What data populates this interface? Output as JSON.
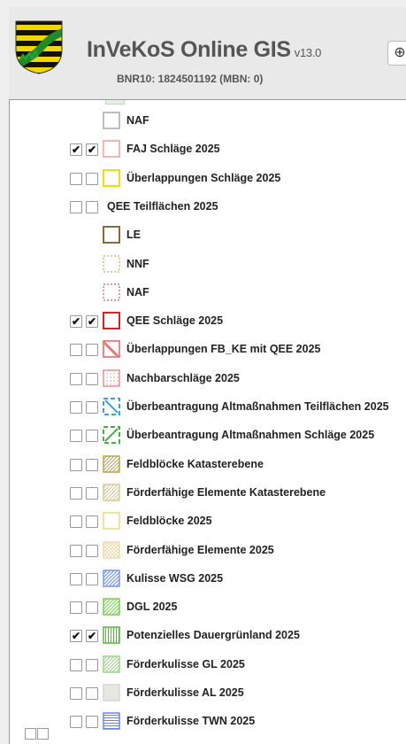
{
  "header": {
    "app_title": "InVeKoS Online GIS",
    "version": "v13.0",
    "bnr": "BNR10: 1824501192 (MBN: 0)",
    "zoom_in_label": "⊕"
  },
  "layers": [
    {
      "label": "NAF",
      "indent": "sub",
      "c1": null,
      "c2": null,
      "symbol": "naf-gray-square"
    },
    {
      "label": "FAJ Schläge 2025",
      "indent": "main",
      "c1": true,
      "c2": true,
      "symbol": "pink-outline-square"
    },
    {
      "label": "Überlappungen Schläge 2025",
      "indent": "main",
      "c1": false,
      "c2": false,
      "symbol": "yellow-outline-square"
    },
    {
      "label": "QEE Teilflächen 2025",
      "indent": "group",
      "c1": false,
      "c2": false,
      "symbol": null
    },
    {
      "label": "LE",
      "indent": "sub",
      "c1": null,
      "c2": null,
      "symbol": "brown-outline-square"
    },
    {
      "label": "NNF",
      "indent": "sub",
      "c1": null,
      "c2": null,
      "symbol": "tan-dotted-square"
    },
    {
      "label": "NAF",
      "indent": "sub",
      "c1": null,
      "c2": null,
      "symbol": "red-dotted-square"
    },
    {
      "label": "QEE Schläge 2025",
      "indent": "main",
      "c1": true,
      "c2": true,
      "symbol": "red-outline-square"
    },
    {
      "label": "Überlappungen FB_KE mit QEE 2025",
      "indent": "main",
      "c1": false,
      "c2": false,
      "symbol": "red-hatched-square"
    },
    {
      "label": "Nachbarschläge 2025",
      "indent": "main",
      "c1": false,
      "c2": false,
      "symbol": "red-dotgrid-square"
    },
    {
      "label": "Überbeantragung Altmaßnahmen Teilflächen 2025",
      "indent": "main",
      "c1": false,
      "c2": false,
      "symbol": "blue-dashed-square"
    },
    {
      "label": "Überbeantragung Altmaßnahmen Schläge 2025",
      "indent": "main",
      "c1": false,
      "c2": false,
      "symbol": "green-dashed-square"
    },
    {
      "label": "Feldblöcke Katasterebene",
      "indent": "main",
      "c1": false,
      "c2": false,
      "symbol": "olive-hatched-square"
    },
    {
      "label": "Förderfähige Elemente Katasterebene",
      "indent": "main",
      "c1": false,
      "c2": false,
      "symbol": "khaki-hatched-square"
    },
    {
      "label": "Feldblöcke 2025",
      "indent": "main",
      "c1": false,
      "c2": false,
      "symbol": "lightyellow-outline-square"
    },
    {
      "label": "Förderfähige Elemente 2025",
      "indent": "main",
      "c1": false,
      "c2": false,
      "symbol": "beige-crosshatch-square"
    },
    {
      "label": "Kulisse WSG 2025",
      "indent": "main",
      "c1": false,
      "c2": false,
      "symbol": "blue-hatched-square"
    },
    {
      "label": "DGL 2025",
      "indent": "main",
      "c1": false,
      "c2": false,
      "symbol": "green-hatched-square"
    },
    {
      "label": "Potenzielles Dauergrünland 2025",
      "indent": "main",
      "c1": true,
      "c2": true,
      "symbol": "green-vertical-lines-square"
    },
    {
      "label": "Förderkulisse GL 2025",
      "indent": "main",
      "c1": false,
      "c2": false,
      "symbol": "lightgreen-hatched-square"
    },
    {
      "label": "Förderkulisse AL 2025",
      "indent": "main",
      "c1": false,
      "c2": false,
      "symbol": "gray-filled-square"
    },
    {
      "label": "Förderkulisse TWN 2025",
      "indent": "main",
      "c1": false,
      "c2": false,
      "symbol": "blue-horizontal-lines-square"
    }
  ]
}
